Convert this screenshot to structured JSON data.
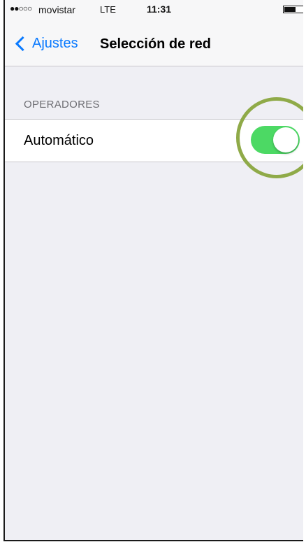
{
  "status_bar": {
    "signal": "●●○○○",
    "carrier": "movistar",
    "network": "LTE",
    "time": "11:31",
    "battery_level": 0.6
  },
  "nav": {
    "back_label": "Ajustes",
    "title": "Selección de red"
  },
  "section": {
    "header": "OPERADORES",
    "rows": [
      {
        "label": "Automático",
        "toggle_on": true
      }
    ]
  },
  "colors": {
    "accent": "#0a7aff",
    "toggle_on": "#4cd964",
    "highlight_ring": "#8faa48",
    "background": "#efeff4"
  }
}
